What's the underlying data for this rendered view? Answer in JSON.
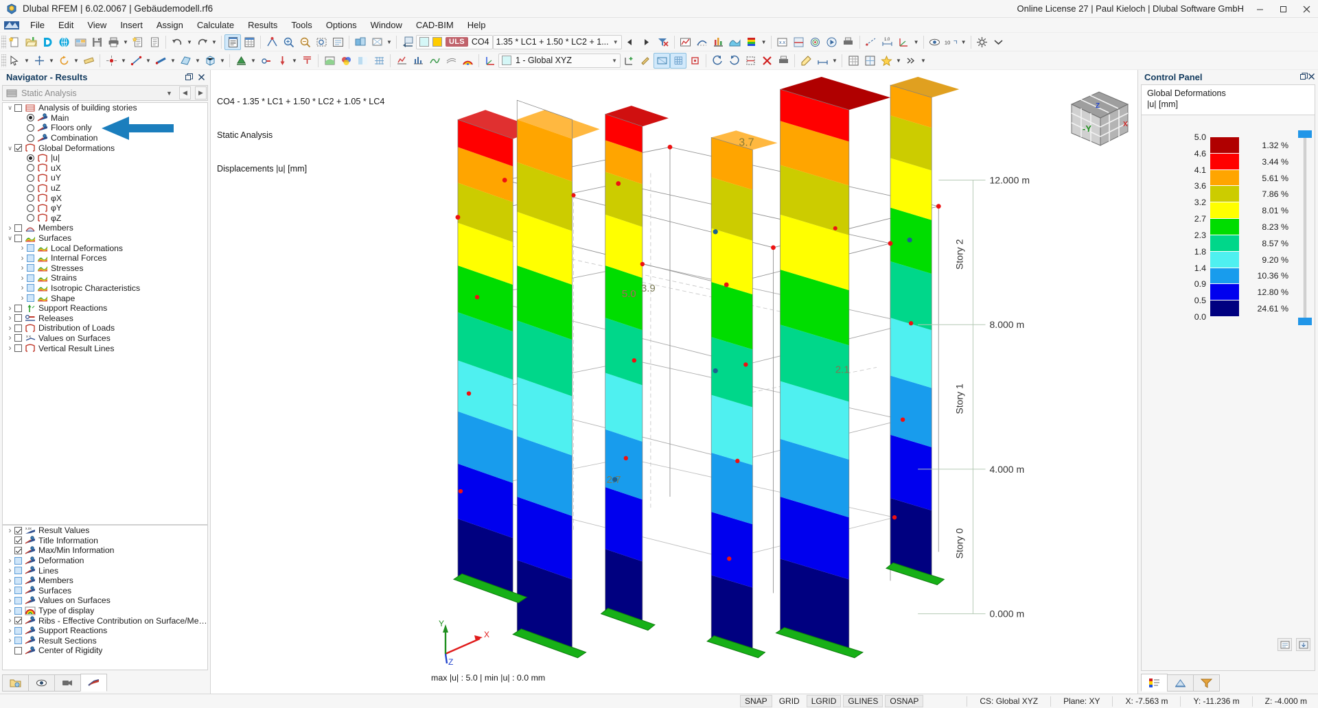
{
  "window": {
    "title": "Dlubal RFEM | 6.02.0067 | Gebäudemodell.rf6",
    "license": "Online License 27 | Paul Kieloch | Dlubal Software GmbH",
    "minimize": "—",
    "maximize": "❐",
    "close": "✕"
  },
  "menu": [
    "File",
    "Edit",
    "View",
    "Insert",
    "Assign",
    "Calculate",
    "Results",
    "Tools",
    "Options",
    "Window",
    "CAD-BIM",
    "Help"
  ],
  "toolbar_main": {
    "load_case_badge": "ULS",
    "load_case_code": "CO4",
    "load_case_formula": "1.35 * LC1 + 1.50 * LC2 + 1...",
    "swatch_light": "#d5f7f7",
    "swatch_yellow": "#ffcc00",
    "zoom_value": "10"
  },
  "toolbar_second": {
    "cs_value": "1 - Global XYZ",
    "cs_swatch": "#d5f7f7"
  },
  "navigator": {
    "title": "Navigator - Results",
    "selector": "Static Analysis",
    "tree_top": [
      {
        "indent": 1,
        "exp": "open",
        "ctrl": "cbx",
        "icon": "building-stories-icon",
        "label": "Analysis of building stories"
      },
      {
        "indent": 2,
        "exp": "none",
        "ctrl": "rad-on",
        "icon": "display-icon",
        "label": "Main"
      },
      {
        "indent": 2,
        "exp": "none",
        "ctrl": "rad",
        "icon": "display-icon",
        "label": "Floors only"
      },
      {
        "indent": 2,
        "exp": "none",
        "ctrl": "rad",
        "icon": "display-icon",
        "label": "Combination"
      },
      {
        "indent": 1,
        "exp": "open",
        "ctrl": "cbx-checked",
        "icon": "deformation-icon",
        "label": "Global Deformations"
      },
      {
        "indent": 2,
        "exp": "none",
        "ctrl": "rad-on",
        "icon": "deformation-icon",
        "label": "|u|"
      },
      {
        "indent": 2,
        "exp": "none",
        "ctrl": "rad",
        "icon": "deformation-icon",
        "label": "uX"
      },
      {
        "indent": 2,
        "exp": "none",
        "ctrl": "rad",
        "icon": "deformation-icon",
        "label": "uY"
      },
      {
        "indent": 2,
        "exp": "none",
        "ctrl": "rad",
        "icon": "deformation-icon",
        "label": "uZ"
      },
      {
        "indent": 2,
        "exp": "none",
        "ctrl": "rad",
        "icon": "deformation-icon",
        "label": "φX"
      },
      {
        "indent": 2,
        "exp": "none",
        "ctrl": "rad",
        "icon": "deformation-icon",
        "label": "φY"
      },
      {
        "indent": 2,
        "exp": "none",
        "ctrl": "rad",
        "icon": "deformation-icon",
        "label": "φZ"
      },
      {
        "indent": 1,
        "exp": "closed",
        "ctrl": "cbx",
        "icon": "members-icon",
        "label": "Members"
      },
      {
        "indent": 1,
        "exp": "open",
        "ctrl": "cbx",
        "icon": "surfaces-icon",
        "label": "Surfaces"
      },
      {
        "indent": 2,
        "exp": "closed",
        "ctrl": "cbx-blue",
        "icon": "surfaces-icon",
        "label": "Local Deformations"
      },
      {
        "indent": 2,
        "exp": "closed",
        "ctrl": "cbx-blue",
        "icon": "surfaces-icon",
        "label": "Internal Forces"
      },
      {
        "indent": 2,
        "exp": "closed",
        "ctrl": "cbx-blue",
        "icon": "surfaces-icon",
        "label": "Stresses"
      },
      {
        "indent": 2,
        "exp": "closed",
        "ctrl": "cbx-blue",
        "icon": "surfaces-icon",
        "label": "Strains"
      },
      {
        "indent": 2,
        "exp": "closed",
        "ctrl": "cbx-blue",
        "icon": "surfaces-icon",
        "label": "Isotropic Characteristics"
      },
      {
        "indent": 2,
        "exp": "closed",
        "ctrl": "cbx-blue",
        "icon": "surfaces-icon",
        "label": "Shape"
      },
      {
        "indent": 1,
        "exp": "closed",
        "ctrl": "cbx",
        "icon": "support-reactions-icon",
        "label": "Support Reactions"
      },
      {
        "indent": 1,
        "exp": "closed",
        "ctrl": "cbx",
        "icon": "releases-icon",
        "label": "Releases"
      },
      {
        "indent": 1,
        "exp": "closed",
        "ctrl": "cbx",
        "icon": "deformation-icon",
        "label": "Distribution of Loads"
      },
      {
        "indent": 1,
        "exp": "closed",
        "ctrl": "cbx",
        "icon": "values-icon",
        "label": "Values on Surfaces"
      },
      {
        "indent": 1,
        "exp": "closed",
        "ctrl": "cbx",
        "icon": "deformation-icon",
        "label": "Vertical Result Lines"
      }
    ],
    "tree_bottom": [
      {
        "indent": 1,
        "exp": "closed",
        "ctrl": "cbx-checked",
        "icon": "result-values-icon",
        "label": "Result Values"
      },
      {
        "indent": 1,
        "exp": "none",
        "ctrl": "cbx-checked",
        "icon": "display-icon",
        "label": "Title Information"
      },
      {
        "indent": 1,
        "exp": "none",
        "ctrl": "cbx-checked",
        "icon": "display-icon",
        "label": "Max/Min Information"
      },
      {
        "indent": 1,
        "exp": "closed",
        "ctrl": "cbx-blue",
        "icon": "display-icon",
        "label": "Deformation"
      },
      {
        "indent": 1,
        "exp": "closed",
        "ctrl": "cbx-blue",
        "icon": "display-icon",
        "label": "Lines"
      },
      {
        "indent": 1,
        "exp": "closed",
        "ctrl": "cbx-blue",
        "icon": "display-icon",
        "label": "Members"
      },
      {
        "indent": 1,
        "exp": "closed",
        "ctrl": "cbx-blue",
        "icon": "display-icon",
        "label": "Surfaces"
      },
      {
        "indent": 1,
        "exp": "closed",
        "ctrl": "cbx-blue",
        "icon": "display-icon",
        "label": "Values on Surfaces"
      },
      {
        "indent": 1,
        "exp": "closed",
        "ctrl": "cbx-blue",
        "icon": "rainbow-icon",
        "label": "Type of display"
      },
      {
        "indent": 1,
        "exp": "closed",
        "ctrl": "cbx-checked",
        "icon": "display-icon",
        "label": "Ribs - Effective Contribution on Surface/Mem..."
      },
      {
        "indent": 1,
        "exp": "closed",
        "ctrl": "cbx-blue",
        "icon": "display-icon",
        "label": "Support Reactions"
      },
      {
        "indent": 1,
        "exp": "closed",
        "ctrl": "cbx-blue",
        "icon": "display-icon",
        "label": "Result Sections"
      },
      {
        "indent": 1,
        "exp": "none",
        "ctrl": "cbx",
        "icon": "display-icon",
        "label": "Center of Rigidity"
      }
    ],
    "tabs": [
      "open-icon",
      "eye-icon",
      "camera-icon",
      "results-icon"
    ]
  },
  "viewport": {
    "caption_line1": "CO4 - 1.35 * LC1 + 1.50 * LC2 + 1.05 * LC4",
    "caption_line2": "Static Analysis",
    "caption_line3": "Displacements |u| [mm]",
    "minmax": "max |u| : 5.0 | min |u| : 0.0 mm",
    "axis_x": "X",
    "axis_y": "Y",
    "axis_z": "Z",
    "viewcube_label": "-Y",
    "story_labels": [
      "Story 2",
      "Story 1",
      "Story 0"
    ],
    "elevations": [
      "12.000 m",
      "8.000 m",
      "4.000 m",
      "0.000 m"
    ],
    "value_labels": [
      "3.7",
      "3.9",
      "5.0",
      "2.1",
      "2.7"
    ]
  },
  "control_panel": {
    "title": "Control Panel",
    "header_line1": "Global Deformations",
    "header_line2": "|u| [mm]",
    "legend": {
      "scale": [
        "5.0",
        "4.6",
        "4.1",
        "3.6",
        "3.2",
        "2.7",
        "2.3",
        "1.8",
        "1.4",
        "0.9",
        "0.5",
        "0.0"
      ],
      "bands": [
        {
          "color": "#b00000",
          "percent": "1.32 %"
        },
        {
          "color": "#ff0000",
          "percent": "3.44 %"
        },
        {
          "color": "#ffa500",
          "percent": "5.61 %"
        },
        {
          "color": "#cccc00",
          "percent": "7.86 %"
        },
        {
          "color": "#ffff00",
          "percent": "8.01 %"
        },
        {
          "color": "#00dd00",
          "percent": "8.23 %"
        },
        {
          "color": "#00d78a",
          "percent": "8.57 %"
        },
        {
          "color": "#4ff0f0",
          "percent": "9.20 %"
        },
        {
          "color": "#189ced",
          "percent": "10.36 %"
        },
        {
          "color": "#0000ee",
          "percent": "12.80 %"
        },
        {
          "color": "#000080",
          "percent": "24.61 %"
        }
      ],
      "slider_color": "#2196e8"
    },
    "tabs": [
      "legend-icon",
      "factors-icon",
      "filter-icon"
    ]
  },
  "statusbar": {
    "chips": [
      "SNAP",
      "GRID",
      "LGRID",
      "GLINES",
      "OSNAP"
    ],
    "cs": "CS: Global XYZ",
    "plane": "Plane: XY",
    "x": "X: -7.563 m",
    "y": "Y: -11.236 m",
    "z": "Z: -4.000 m"
  },
  "chart_data": {
    "type": "heatmap",
    "title": "Displacements |u| [mm] — CO4 - 1.35 * LC1 + 1.50 * LC2 + 1.05 * LC4",
    "value_min": 0.0,
    "value_max": 5.0,
    "unit": "mm",
    "scale_ticks": [
      5.0,
      4.6,
      4.1,
      3.6,
      3.2,
      2.7,
      2.3,
      1.8,
      1.4,
      0.9,
      0.5,
      0.0
    ],
    "band_percentages": [
      1.32,
      3.44,
      5.61,
      7.86,
      8.01,
      8.23,
      8.57,
      9.2,
      10.36,
      12.8,
      24.61
    ],
    "band_colors": [
      "#b00000",
      "#ff0000",
      "#ffa500",
      "#cccc00",
      "#ffff00",
      "#00dd00",
      "#00d78a",
      "#4ff0f0",
      "#189ced",
      "#0000ee",
      "#000080"
    ],
    "story_elevations_m": [
      0.0,
      4.0,
      8.0,
      12.0
    ],
    "story_names": [
      "Story 0",
      "Story 1",
      "Story 2"
    ]
  }
}
